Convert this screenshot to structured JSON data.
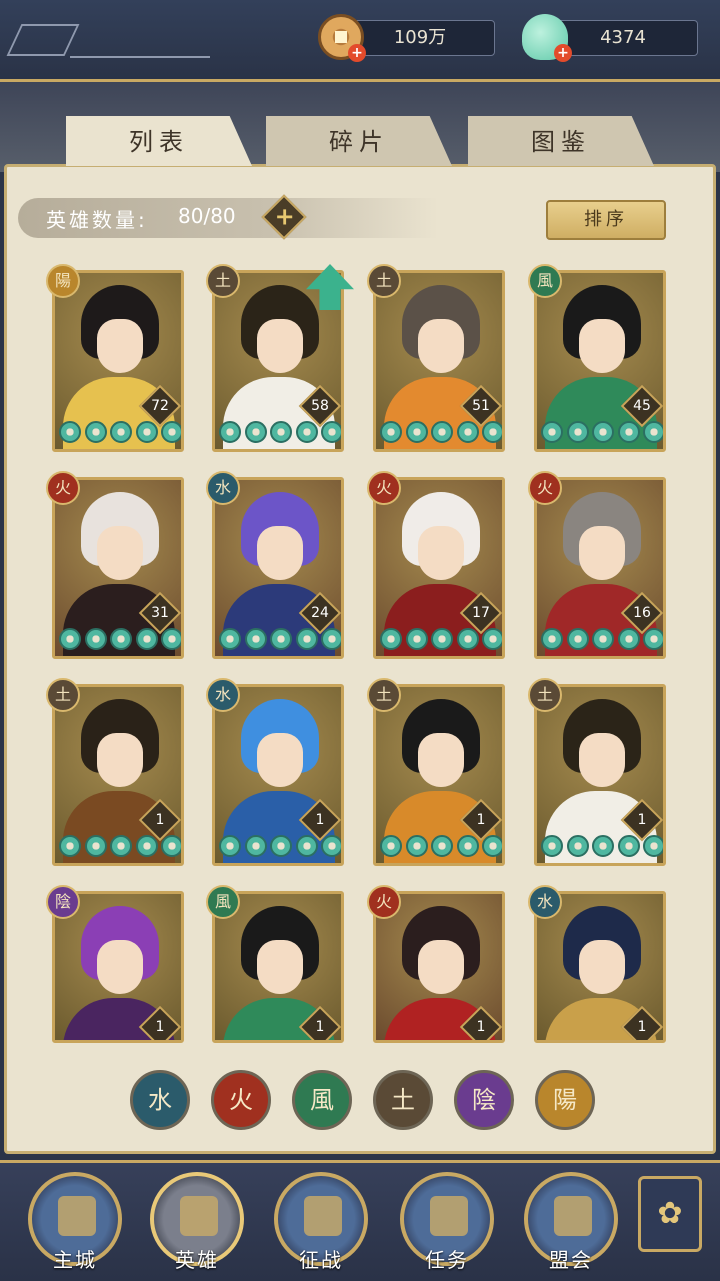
{
  "currency": {
    "coins": "109万",
    "shells": "4374"
  },
  "tabs": [
    "列表",
    "碎片",
    "图鉴"
  ],
  "hero_count": {
    "label": "英雄数量:",
    "value": "80/80"
  },
  "sort_label": "排序",
  "heroes": [
    {
      "element": "陽",
      "level": "72",
      "hair": "#1e1a1a",
      "body": "#e6c14f",
      "bg": "#6b5a2e"
    },
    {
      "element": "土",
      "level": "58",
      "hair": "#2b2418",
      "body": "#f1eee6",
      "bg": "#6b5a2e"
    },
    {
      "element": "土",
      "level": "51",
      "hair": "#5b5148",
      "body": "#e38a2f",
      "bg": "#6b5a2e"
    },
    {
      "element": "風",
      "level": "45",
      "hair": "#1a1a1a",
      "body": "#2f8a5a",
      "bg": "#6b5a2e"
    },
    {
      "element": "火",
      "level": "31",
      "hair": "#e8e2dd",
      "body": "#2b1e1e",
      "bg": "#6b4a2e"
    },
    {
      "element": "水",
      "level": "24",
      "hair": "#6c55c8",
      "body": "#2c3a7a",
      "bg": "#6b4a2e"
    },
    {
      "element": "火",
      "level": "17",
      "hair": "#f0ece8",
      "body": "#8b1e1e",
      "bg": "#6b4a2e"
    },
    {
      "element": "火",
      "level": "16",
      "hair": "#8a8580",
      "body": "#a02828",
      "bg": "#6b4a2e"
    },
    {
      "element": "土",
      "level": "1",
      "hair": "#2a2218",
      "body": "#7a4a22",
      "bg": "#6b5a2e"
    },
    {
      "element": "水",
      "level": "1",
      "hair": "#3f8fe0",
      "body": "#2a5fa8",
      "bg": "#6b5a2e"
    },
    {
      "element": "土",
      "level": "1",
      "hair": "#1a1a1a",
      "body": "#d88a2a",
      "bg": "#6b5a2e"
    },
    {
      "element": "土",
      "level": "1",
      "hair": "#2b2418",
      "body": "#f1eee6",
      "bg": "#6b5a2e"
    },
    {
      "element": "陰",
      "level": "1",
      "hair": "#8b3fb5",
      "body": "#4a2560",
      "bg": "#6b5a2e"
    },
    {
      "element": "風",
      "level": "1",
      "hair": "#1a1a1a",
      "body": "#2f8a5a",
      "bg": "#6b5a2e"
    },
    {
      "element": "火",
      "level": "1",
      "hair": "#2b1e1e",
      "body": "#b02222",
      "bg": "#6b4a2e"
    },
    {
      "element": "水",
      "level": "1",
      "hair": "#1e2a4a",
      "body": "#c9a04a",
      "bg": "#6b5a2e"
    }
  ],
  "element_colors": {
    "陽": "#b9862c",
    "土": "#5a4a36",
    "風": "#2f7a52",
    "火": "#a0301f",
    "水": "#2b5b6b",
    "陰": "#6a3c8f"
  },
  "element_filters": [
    {
      "label": "水",
      "color": "#2b5b6b"
    },
    {
      "label": "火",
      "color": "#a0301f"
    },
    {
      "label": "風",
      "color": "#2f7a52"
    },
    {
      "label": "土",
      "color": "#5a4a36"
    },
    {
      "label": "陰",
      "color": "#6a3c8f"
    },
    {
      "label": "陽",
      "color": "#b9862c"
    }
  ],
  "nav": [
    {
      "label": "主城",
      "icon": "city-gate-icon"
    },
    {
      "label": "英雄",
      "icon": "hero-portrait-icon",
      "active": true
    },
    {
      "label": "征战",
      "icon": "campaign-drum-icon"
    },
    {
      "label": "任务",
      "icon": "task-scroll-icon"
    },
    {
      "label": "盟会",
      "icon": "alliance-hall-icon"
    }
  ],
  "menu_icon": "flower-menu-icon"
}
